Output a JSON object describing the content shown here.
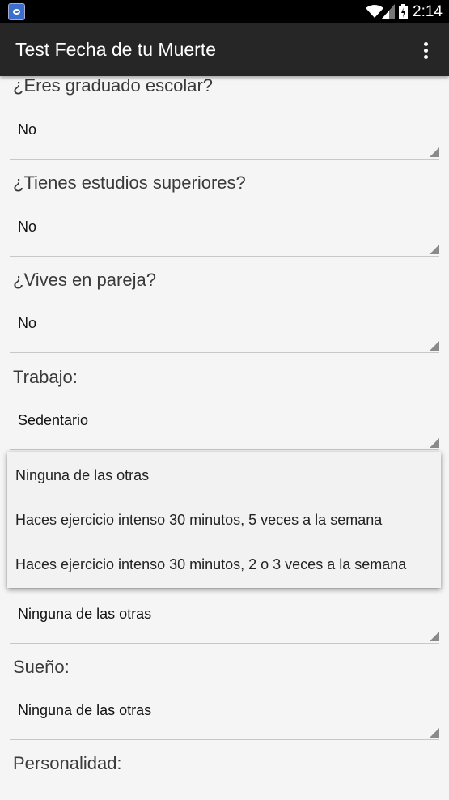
{
  "status_bar": {
    "time": "2:14",
    "icons": [
      "app-notification-icon",
      "wifi-icon",
      "signal-icon",
      "battery-icon"
    ]
  },
  "action_bar": {
    "title": "Test Fecha de tu Muerte",
    "overflow_icon": "more-vert-icon"
  },
  "form": [
    {
      "question": "¿Eres graduado escolar?",
      "value": "No"
    },
    {
      "question": "¿Tienes estudios superiores?",
      "value": "No"
    },
    {
      "question": "¿Vives en pareja?",
      "value": "No"
    },
    {
      "question": "Trabajo:",
      "value": "Sedentario"
    },
    {
      "question": "",
      "value": "Ninguna de las otras"
    },
    {
      "question": "Sueño:",
      "value": "Ninguna de las otras"
    },
    {
      "question": "Personalidad:"
    }
  ],
  "dropdown": {
    "options": [
      "Ninguna de las otras",
      "Haces ejercicio intenso 30 minutos, 5 veces a la semana",
      "Haces ejercicio intenso 30 minutos, 2 o 3 veces a la semana"
    ]
  }
}
